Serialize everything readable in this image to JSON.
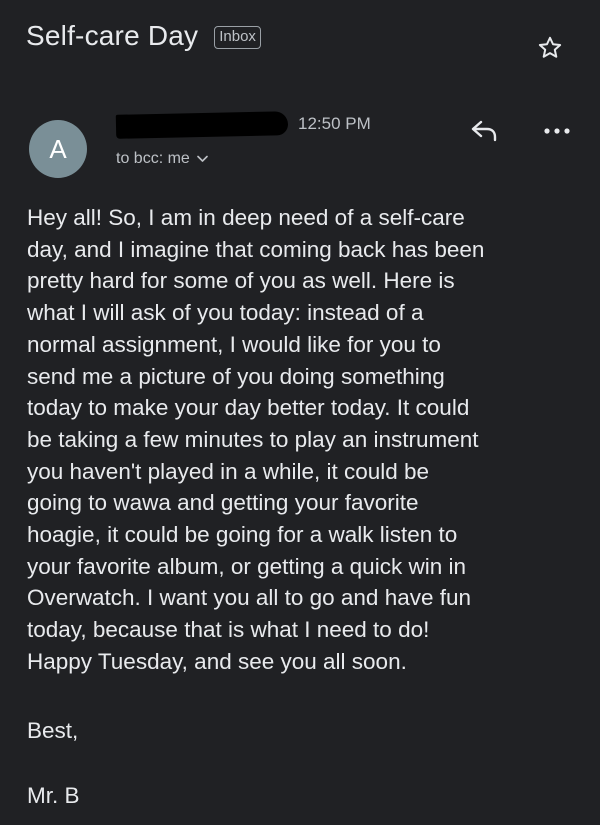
{
  "email": {
    "subject": "Self-care Day",
    "label": "Inbox",
    "avatar_letter": "A",
    "time": "12:50 PM",
    "recipients": "to bcc: me",
    "body_lines": [
      "Hey all! So, I am in deep need of a self-care",
      "day, and I imagine that coming back has been",
      "pretty hard for some of you as well. Here is",
      "what I will ask of you today: instead of a",
      "normal assignment, I would like for you to",
      "send me a picture of you doing something",
      "today to make your day better today. It could",
      "be taking a few minutes to play an instrument",
      "you haven't played in a while, it could be",
      "going to wawa and getting your favorite",
      "hoagie, it could be going for a walk listen to",
      "your favorite album, or getting a quick win in",
      "Overwatch. I want you all to go and have fun",
      "today, because that is what I need to do!",
      "Happy Tuesday, and see you all soon."
    ],
    "signoff": "Best,",
    "signature": "Mr. B"
  },
  "icons": {
    "star": "star-icon",
    "reply": "reply-icon",
    "more": "more-horizontal-icon",
    "chevron": "chevron-down-icon"
  },
  "colors": {
    "background": "#202124",
    "text": "#e8eaed",
    "secondary_text": "#bdc1c6",
    "avatar": "#7a8f97"
  }
}
